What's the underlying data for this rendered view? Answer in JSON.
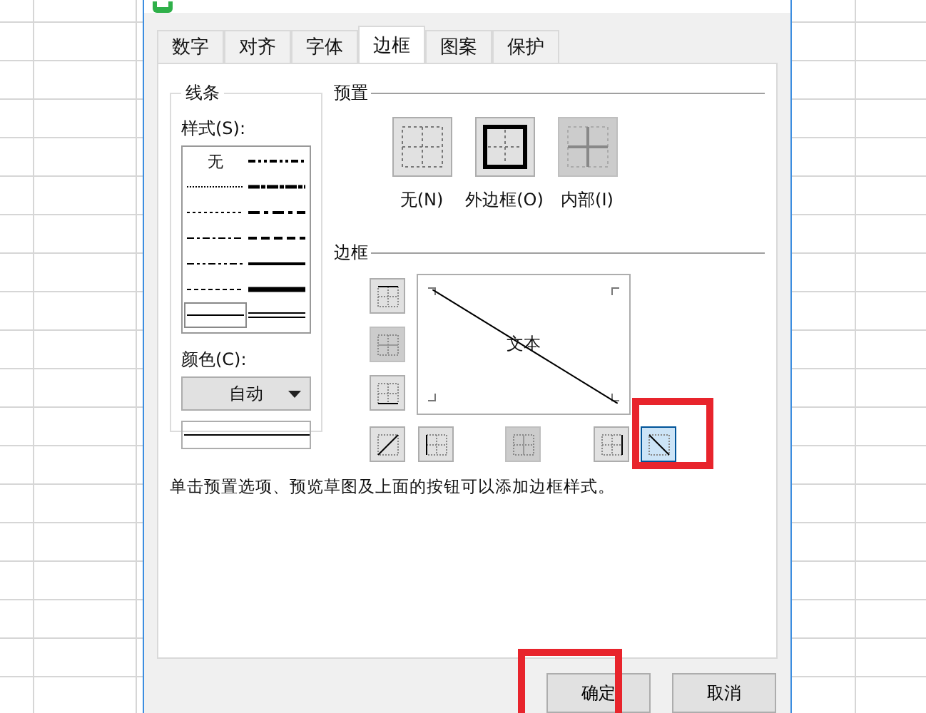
{
  "tabs": [
    {
      "label": "数字",
      "selected": false
    },
    {
      "label": "对齐",
      "selected": false
    },
    {
      "label": "字体",
      "selected": false
    },
    {
      "label": "边框",
      "selected": true
    },
    {
      "label": "图案",
      "selected": false
    },
    {
      "label": "保护",
      "selected": false
    }
  ],
  "line_group": {
    "title": "线条",
    "style_label": "样式(S):",
    "styles": [
      {
        "kind": "none",
        "label": "无",
        "selected": false
      },
      {
        "kind": "medium-dash-dot-dot",
        "selected": false
      },
      {
        "kind": "hair",
        "selected": false
      },
      {
        "kind": "slant-dash-dot",
        "selected": false
      },
      {
        "kind": "dotted",
        "selected": false
      },
      {
        "kind": "medium-dash-dot",
        "selected": false
      },
      {
        "kind": "dash-dot",
        "selected": false
      },
      {
        "kind": "medium-dashed",
        "selected": false
      },
      {
        "kind": "dash-dot-dot",
        "selected": false
      },
      {
        "kind": "medium",
        "selected": false
      },
      {
        "kind": "dashed",
        "selected": false
      },
      {
        "kind": "thick",
        "selected": false
      },
      {
        "kind": "thin",
        "selected": true
      },
      {
        "kind": "double",
        "selected": false
      }
    ],
    "color_label": "颜色(C):",
    "color_value": "自动"
  },
  "presets": {
    "title": "预置",
    "items": [
      {
        "kind": "none",
        "label": "无(N)",
        "disabled": false
      },
      {
        "kind": "outline",
        "label": "外边框(O)",
        "disabled": false
      },
      {
        "kind": "inside",
        "label": "内部(I)",
        "disabled": true
      }
    ]
  },
  "border": {
    "title": "边框",
    "preview_text": "文本",
    "side_buttons": [
      {
        "kind": "top",
        "selected": false,
        "disabled": false
      },
      {
        "kind": "middle-h",
        "selected": false,
        "disabled": true
      },
      {
        "kind": "bottom",
        "selected": false,
        "disabled": false
      }
    ],
    "bottom_buttons": [
      {
        "kind": "diag-up",
        "selected": false,
        "disabled": false,
        "highlighted": false
      },
      {
        "kind": "left",
        "selected": false,
        "disabled": false,
        "highlighted": false
      },
      {
        "kind": "middle-v",
        "selected": false,
        "disabled": true,
        "highlighted": false
      },
      {
        "kind": "right",
        "selected": false,
        "disabled": false,
        "highlighted": false
      },
      {
        "kind": "diag-down",
        "selected": true,
        "disabled": false,
        "highlighted": true
      }
    ]
  },
  "hint": "单击预置选项、预览草图及上面的按钮可以添加边框样式。",
  "buttons": [
    {
      "label": "确定",
      "highlighted": true
    },
    {
      "label": "取消",
      "highlighted": false
    }
  ]
}
